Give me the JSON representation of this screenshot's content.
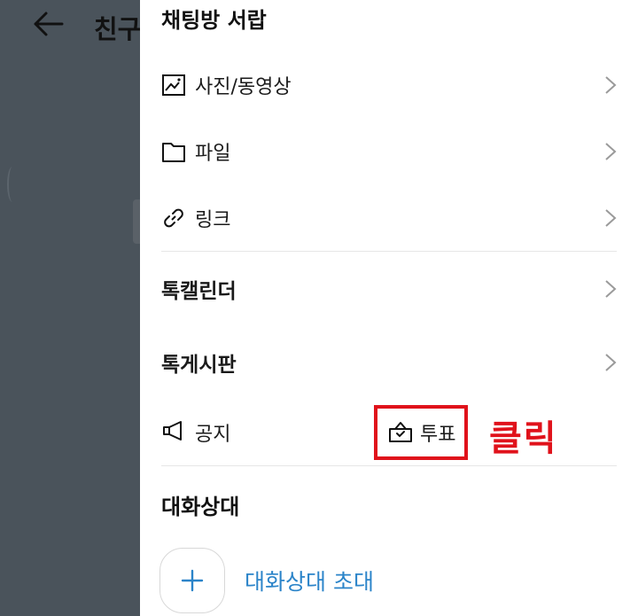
{
  "background": {
    "title": "친구"
  },
  "drawer": {
    "drawer_title": "채팅방 서랍",
    "items": [
      {
        "label": "사진/동영상",
        "icon": "image-icon"
      },
      {
        "label": "파일",
        "icon": "folder-icon"
      },
      {
        "label": "링크",
        "icon": "link-icon"
      }
    ],
    "calendar_label": "톡캘린더",
    "board_label": "톡게시판",
    "notice_label": "공지",
    "vote_label": "투표",
    "annotation": "클릭",
    "members_title": "대화상대",
    "invite_label": "대화상대 초대"
  },
  "colors": {
    "accent_red": "#e0121b",
    "link_blue": "#2b84c9",
    "overlay": "#4a535b"
  }
}
